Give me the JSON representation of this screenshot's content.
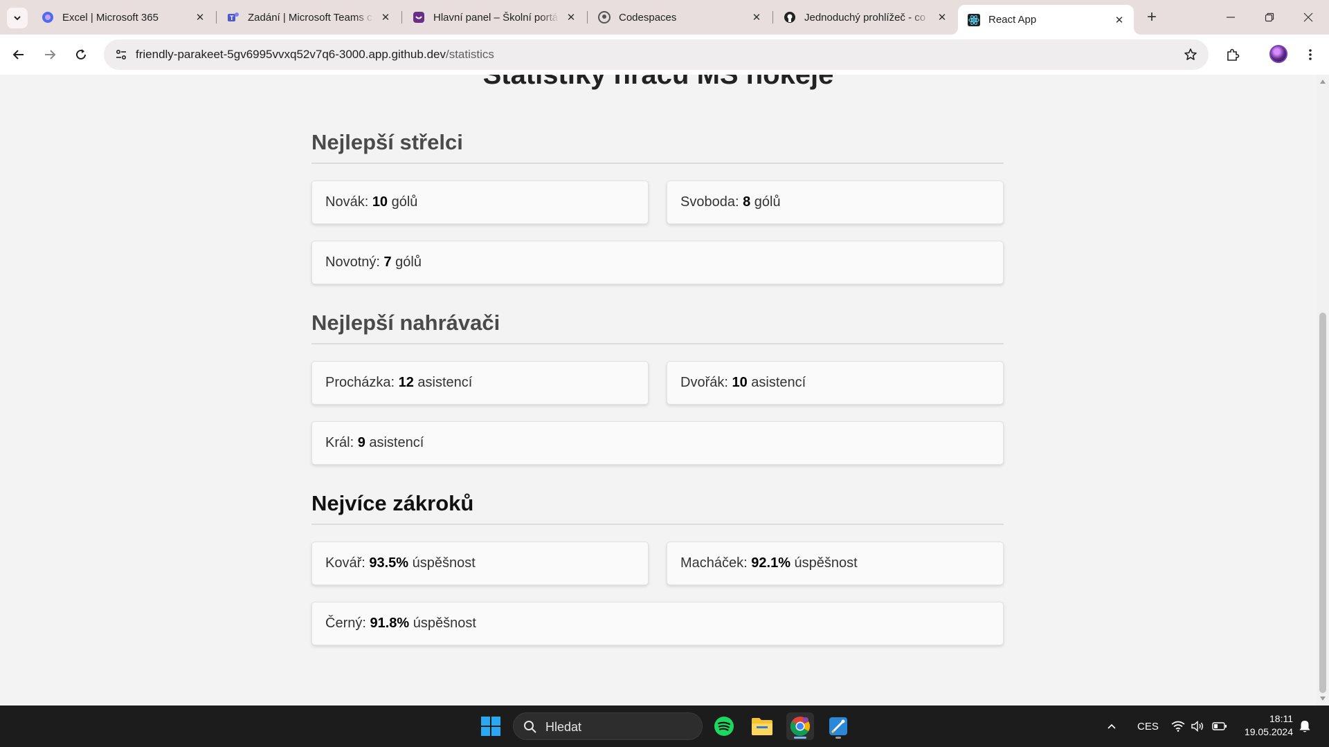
{
  "browser": {
    "tabs": [
      {
        "title": "Excel | Microsoft 365",
        "icon": "microsoft-365-icon"
      },
      {
        "title": "Zadání | Microsoft Teams c",
        "icon": "teams-icon"
      },
      {
        "title": "Hlavní panel – Školní portá",
        "icon": "school-portal-icon"
      },
      {
        "title": "Codespaces",
        "icon": "github-icon"
      },
      {
        "title": "Jednoduchý prohlížeč - co",
        "icon": "github-icon"
      },
      {
        "title": "React App",
        "icon": "react-icon"
      }
    ],
    "url_host": "friendly-parakeet-5gv6995vvxq52v7q6-3000.app.github.dev",
    "url_path": "/statistics"
  },
  "page": {
    "title": "Statistiky hráčů MS hokeje",
    "sections": [
      {
        "heading": "Nejlepší střelci",
        "cards": [
          {
            "name": "Novák: ",
            "value": "10",
            "unit": " gólů"
          },
          {
            "name": "Svoboda: ",
            "value": "8",
            "unit": " gólů"
          },
          {
            "name": "Novotný: ",
            "value": "7",
            "unit": " gólů"
          }
        ]
      },
      {
        "heading": "Nejlepší nahrávači",
        "cards": [
          {
            "name": "Procházka: ",
            "value": "12",
            "unit": " asistencí"
          },
          {
            "name": "Dvořák: ",
            "value": "10",
            "unit": " asistencí"
          },
          {
            "name": "Král: ",
            "value": "9",
            "unit": " asistencí"
          }
        ]
      },
      {
        "heading": "Nejvíce zákroků",
        "cards": [
          {
            "name": "Kovář: ",
            "value": "93.5%",
            "unit": " úspěšnost"
          },
          {
            "name": "Macháček: ",
            "value": "92.1%",
            "unit": " úspěšnost"
          },
          {
            "name": "Černý: ",
            "value": "91.8%",
            "unit": " úspěšnost"
          }
        ]
      }
    ]
  },
  "taskbar": {
    "search_placeholder": "Hledat",
    "language": "CES",
    "time": "18:11",
    "date": "19.05.2024"
  }
}
